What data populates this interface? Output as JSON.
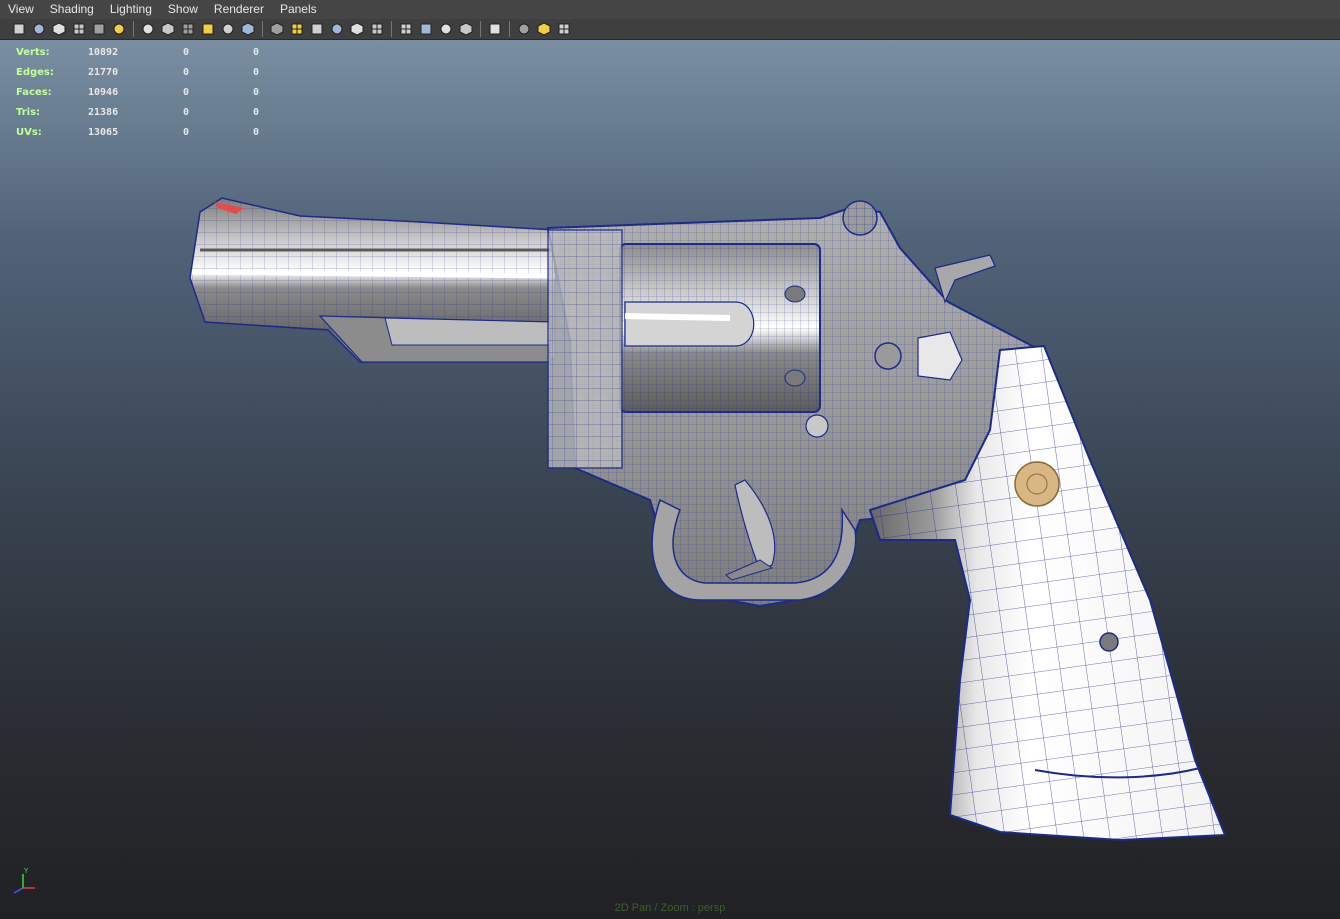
{
  "menu": {
    "items": [
      "View",
      "Shading",
      "Lighting",
      "Show",
      "Renderer",
      "Panels"
    ]
  },
  "toolbar": {
    "groups": [
      [
        "select-camera-icon",
        "camera-attributes-icon",
        "bookmarks-icon",
        "image-plane-icon",
        "2d-pan-zoom-icon",
        "grease-pencil-icon"
      ],
      [
        "grid-icon",
        "film-gate-icon",
        "resolution-gate-icon",
        "gate-mask-icon",
        "field-chart-icon",
        "safe-title-icon"
      ],
      [
        "wireframe-icon",
        "smooth-shade-icon",
        "wireframe-on-shaded-icon",
        "textured-icon",
        "use-all-lights-icon",
        "shadows-icon"
      ],
      [
        "screen-space-ambient-occlusion-icon",
        "motion-blur-icon",
        "multisample-icon",
        "depth-of-field-icon"
      ],
      [
        "isolate-select-icon"
      ],
      [
        "xray-icon",
        "xray-active-components-icon",
        "xray-joints-icon"
      ]
    ]
  },
  "hud": {
    "rows": [
      {
        "label": "Verts:",
        "total": "10892",
        "selected": "0",
        "highlight": "0"
      },
      {
        "label": "Edges:",
        "total": "21770",
        "selected": "0",
        "highlight": "0"
      },
      {
        "label": "Faces:",
        "total": "10946",
        "selected": "0",
        "highlight": "0"
      },
      {
        "label": "Tris:",
        "total": "21386",
        "selected": "0",
        "highlight": "0"
      },
      {
        "label": "UVs:",
        "total": "13065",
        "selected": "0",
        "highlight": "0"
      }
    ]
  },
  "status": {
    "text": "2D Pan / Zoom : persp"
  },
  "axis": {
    "y_label": "Y"
  },
  "colors": {
    "wire": "#1c2a8a",
    "metal_light": "#d6d6d6",
    "metal_mid": "#9a9a9a",
    "metal_dark": "#5c5c5c",
    "grip": "#f4f4f4",
    "medallion": "#d9b783",
    "sight": "#e84a4a"
  }
}
